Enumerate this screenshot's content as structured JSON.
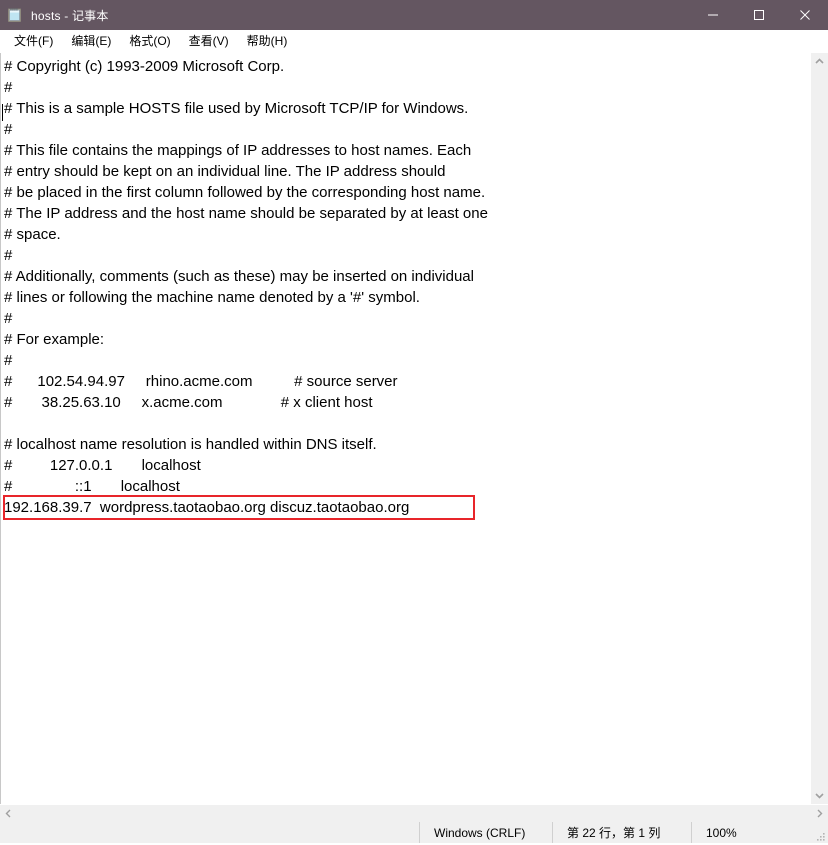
{
  "window": {
    "title": "hosts - 记事本",
    "icon": "notepad-icon",
    "minimize_label": "—",
    "maximize_label": "☐",
    "close_label": "✕",
    "titlebar_color": "#645661"
  },
  "menubar": {
    "items": [
      {
        "label": "文件(F)",
        "name": "menu-file"
      },
      {
        "label": "编辑(E)",
        "name": "menu-edit"
      },
      {
        "label": "格式(O)",
        "name": "menu-format"
      },
      {
        "label": "查看(V)",
        "name": "menu-view"
      },
      {
        "label": "帮助(H)",
        "name": "menu-help"
      }
    ]
  },
  "editor": {
    "lines": [
      "# Copyright (c) 1993-2009 Microsoft Corp.",
      "#",
      "# This is a sample HOSTS file used by Microsoft TCP/IP for Windows.",
      "#",
      "# This file contains the mappings of IP addresses to host names. Each",
      "# entry should be kept on an individual line. The IP address should",
      "# be placed in the first column followed by the corresponding host name.",
      "# The IP address and the host name should be separated by at least one",
      "# space.",
      "#",
      "# Additionally, comments (such as these) may be inserted on individual",
      "# lines or following the machine name denoted by a '#' symbol.",
      "#",
      "# For example:",
      "#",
      "#      102.54.94.97     rhino.acme.com          # source server",
      "#       38.25.63.10     x.acme.com              # x client host",
      "",
      "# localhost name resolution is handled within DNS itself.",
      "#         127.0.0.1       localhost",
      "#               ::1       localhost",
      "192.168.39.7  wordpress.taotaobao.org discuz.taotaobao.org"
    ],
    "highlight": {
      "line_index": 21,
      "text": "192.168.39.7  wordpress.taotaobao.org discuz.taotaobao.org",
      "color": "#e8252a"
    }
  },
  "scrollbars": {
    "vertical": {
      "up_label": "⌃",
      "down_label": "⌄"
    },
    "horizontal": {
      "left_label": "‹",
      "right_label": "›"
    }
  },
  "statusbar": {
    "encoding": "Windows (CRLF)",
    "position": "第 22 行，第 1 列",
    "zoom": "100%"
  }
}
